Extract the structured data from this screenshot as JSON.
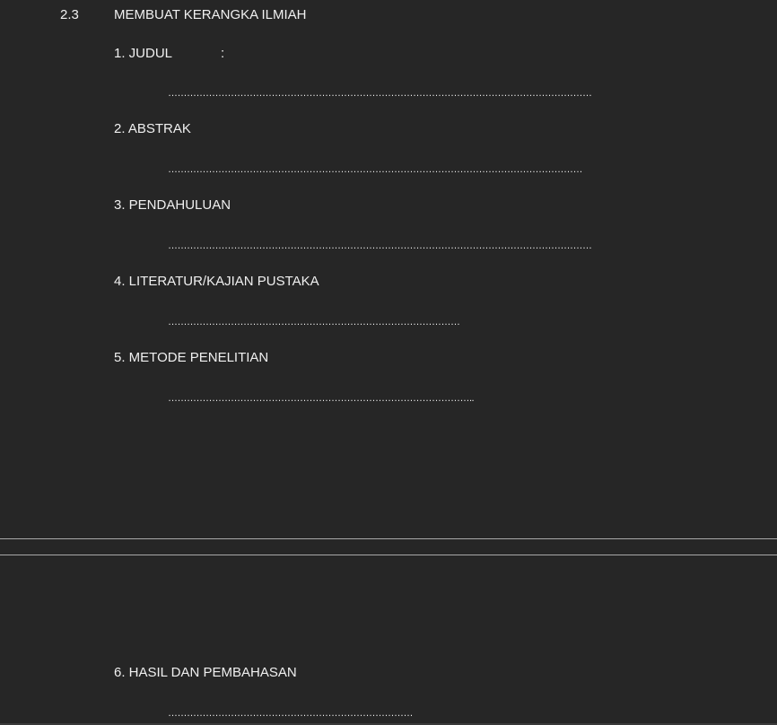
{
  "section": {
    "number": "2.3",
    "title": "MEMBUAT KERANGKA ILMIAH"
  },
  "items": [
    {
      "label": "1. JUDUL",
      "suffix": ":",
      "dots": "………………………………………………………………………………………………………………………"
    },
    {
      "label": "2.  ABSTRAK",
      "dots": "……………………………………………………………………………………………………………………"
    },
    {
      "label": "3. PENDAHULUAN",
      "dots": "………………………………………………………………………………………………………………………"
    },
    {
      "label": "4.  LITERATUR/KAJIAN PUSTAKA",
      "dots": "…………………………………………………………………………………"
    },
    {
      "label": "5.  METODE PENELITIAN",
      "dots": "…………………………………………………………………………………….."
    },
    {
      "label": "6. HASIL DAN PEMBAHASAN",
      "dots": "……………………………………………………………………"
    }
  ]
}
